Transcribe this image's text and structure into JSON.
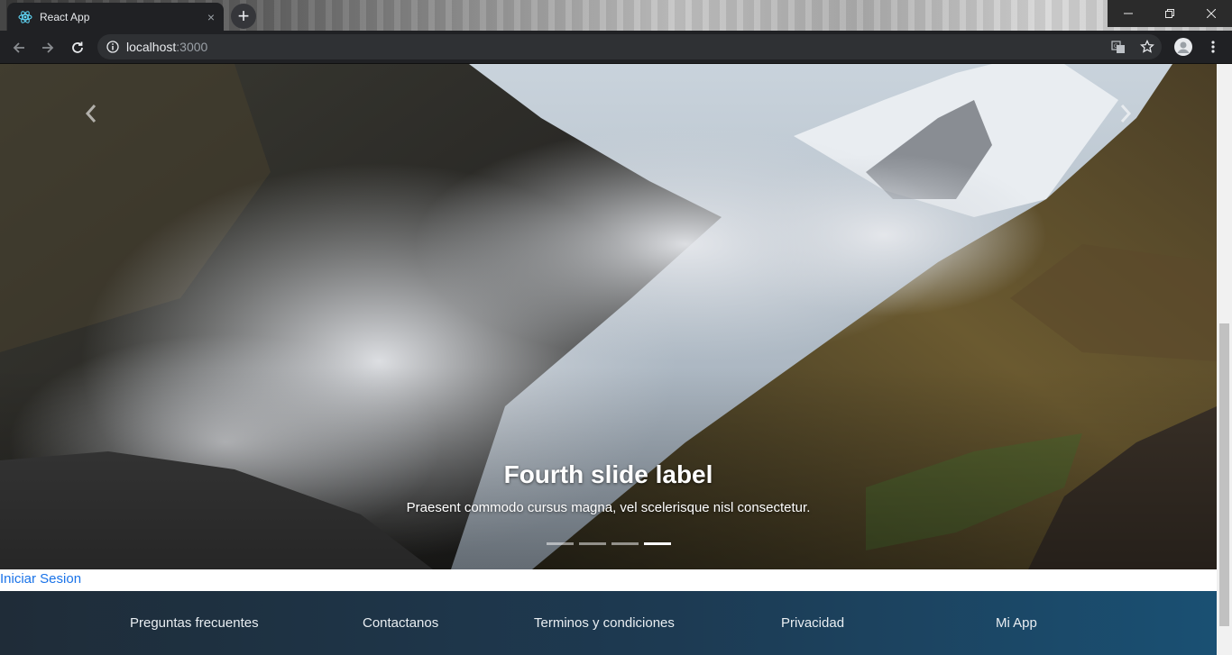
{
  "browser": {
    "tab_title": "React App",
    "tab_close": "×",
    "new_tab": "+",
    "url_host": "localhost",
    "url_port": ":3000",
    "window_controls": [
      "minimize",
      "restore",
      "close"
    ]
  },
  "carousel": {
    "caption_title": "Fourth slide label",
    "caption_text": "Praesent commodo cursus magna, vel scelerisque nisl consectetur.",
    "slide_count": 4,
    "active_slide": 4
  },
  "login_link": "Iniciar Sesion",
  "footer": {
    "links": [
      "Preguntas frecuentes",
      "Contactanos",
      "Terminos y condiciones",
      "Privacidad",
      "Mi App"
    ]
  },
  "colors": {
    "chrome_dark": "#202124",
    "link_blue": "#1a73e8",
    "footer_start": "#1f2c38",
    "footer_end": "#1a5073"
  }
}
